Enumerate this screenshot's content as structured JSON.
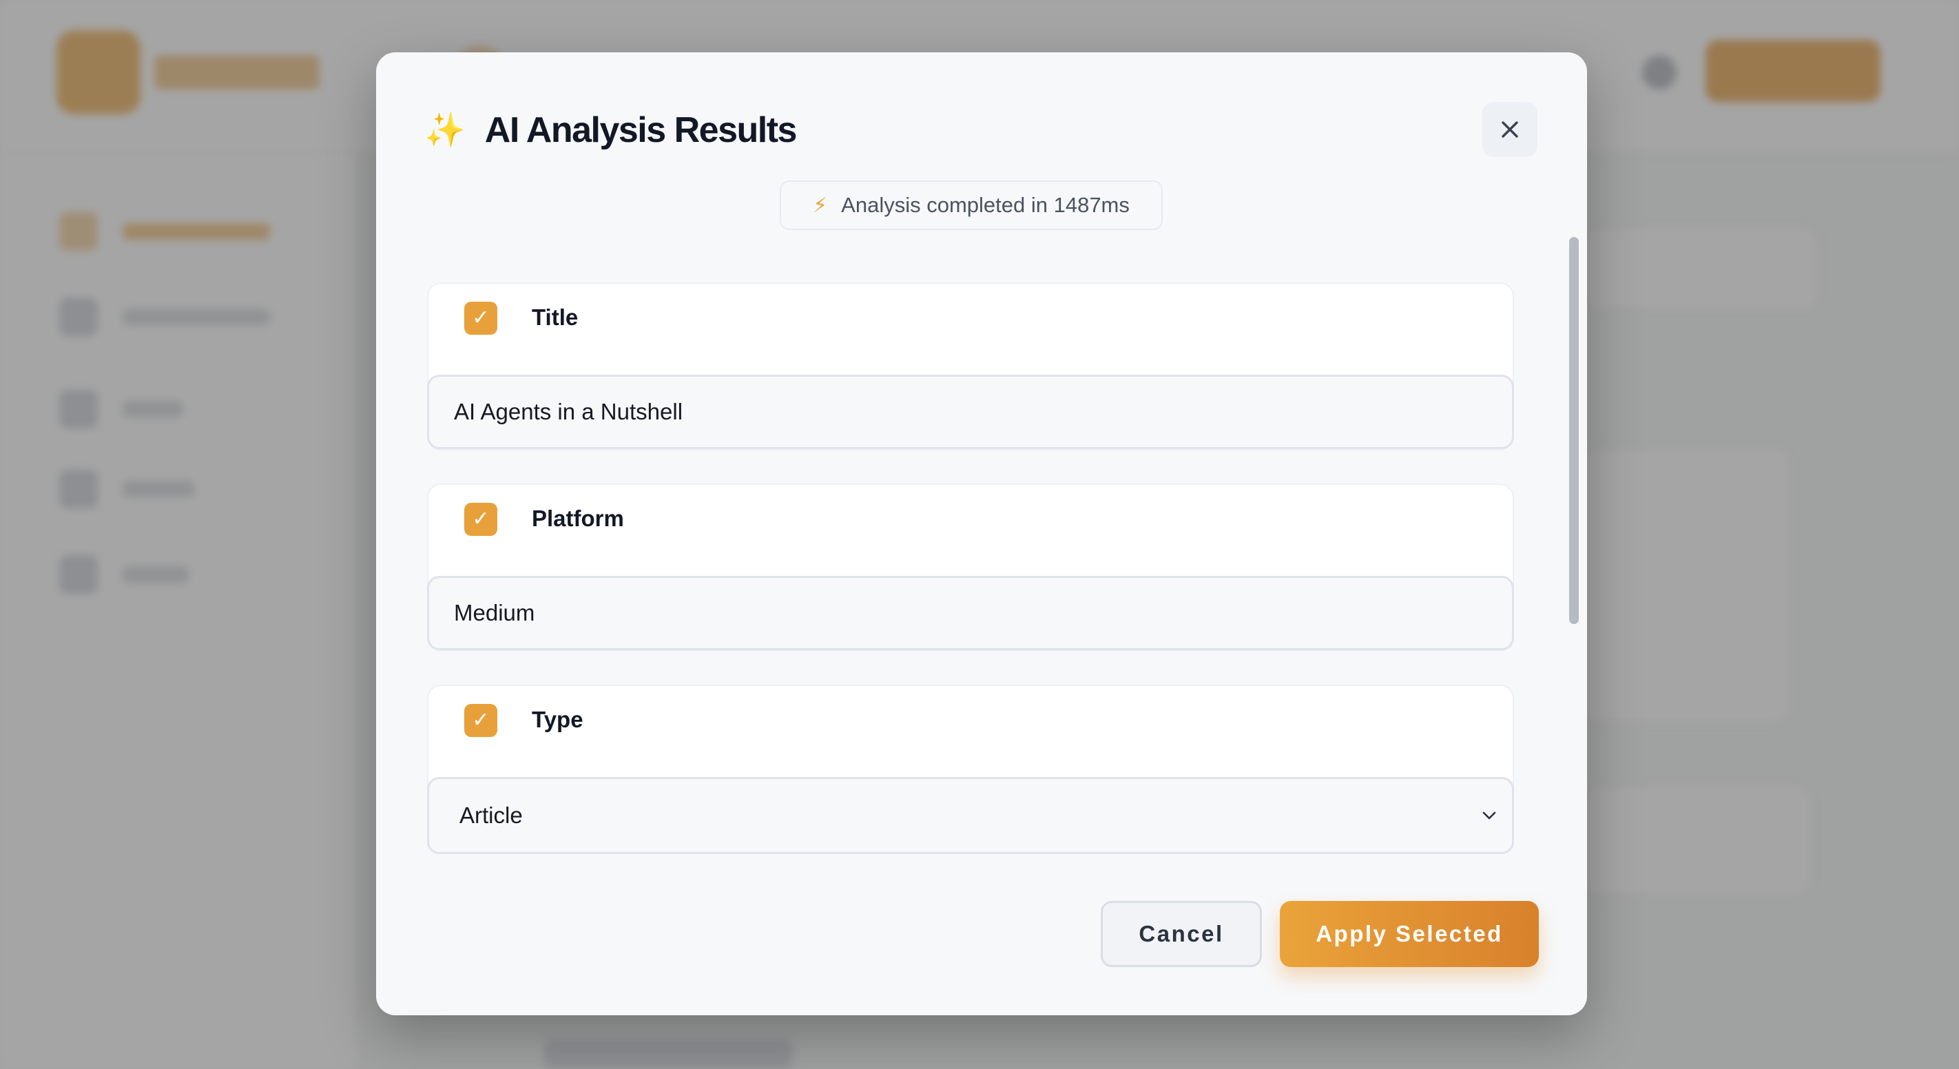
{
  "modal": {
    "title": "AI Analysis Results",
    "title_icon": "sparkle-icon",
    "close_icon": "close-icon",
    "status": {
      "icon": "bolt-icon",
      "text": "Analysis completed in 1487ms"
    },
    "fields": [
      {
        "label": "Title",
        "checked": true,
        "value": "AI Agents in a Nutshell"
      },
      {
        "label": "Platform",
        "checked": true,
        "value": "Medium"
      },
      {
        "label": "Type",
        "checked": true,
        "value": "Article",
        "control": "select"
      }
    ],
    "buttons": {
      "cancel": "Cancel",
      "apply": "Apply Selected"
    }
  },
  "colors": {
    "accent": "#E8A13A",
    "accent_dark": "#D8812C",
    "title_text": "#121826",
    "overlay": "#6E6E6E"
  }
}
